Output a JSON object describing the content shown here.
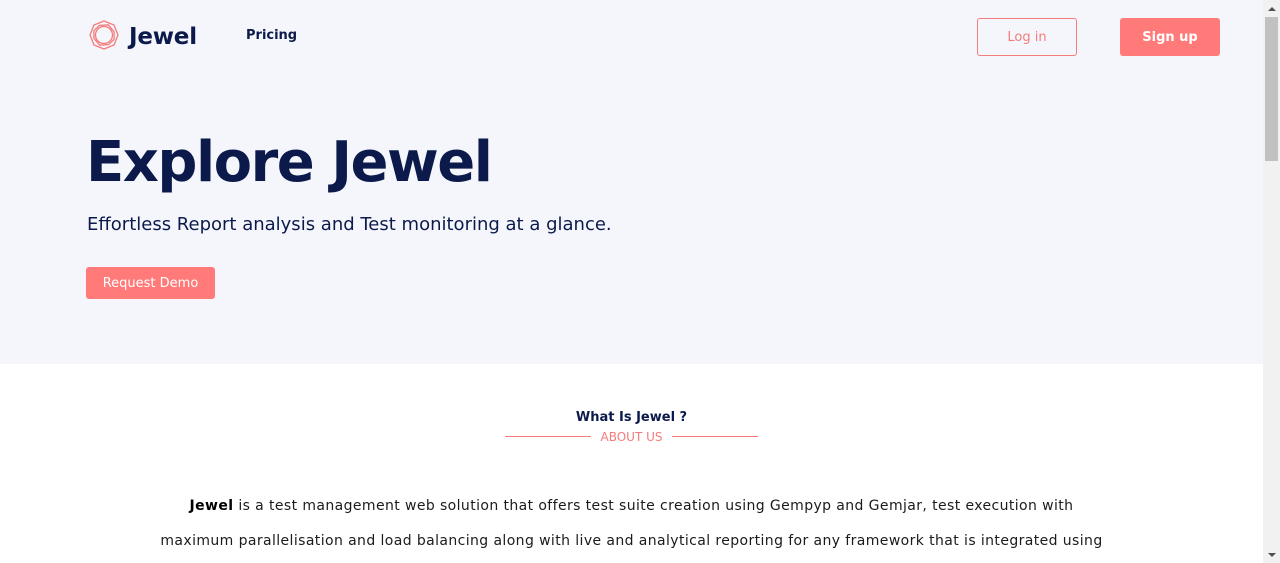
{
  "header": {
    "brand": "Jewel",
    "logo_icon": "jewel-logo-icon",
    "nav_items": [
      {
        "label": "Pricing"
      }
    ],
    "login_label": "Log in",
    "signup_label": "Sign up"
  },
  "hero": {
    "title": "Explore Jewel",
    "subtitle": "Effortless Report analysis and Test monitoring at a glance.",
    "cta_label": "Request Demo"
  },
  "about": {
    "title": "What Is Jewel ?",
    "subtitle": "ABOUT US",
    "lead": "Jewel",
    "line1": " is a test management web solution that offers test suite creation using Gempyp and Gemjar, test execution with",
    "line2": "maximum parallelisation and load balancing along with live and analytical reporting for any framework that is integrated using"
  },
  "colors": {
    "accent": "#ff7a78",
    "navy": "#0b1a4b",
    "hero_bg": "#f5f6fb"
  }
}
